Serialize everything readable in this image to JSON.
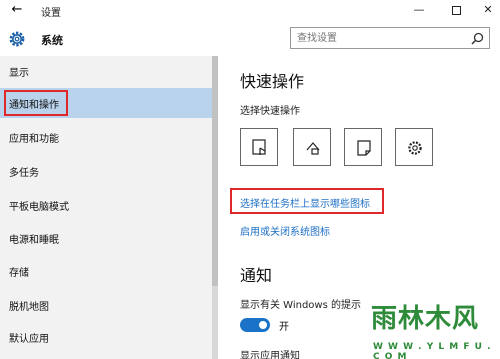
{
  "titlebar": {
    "back_icon": "back-arrow-icon",
    "title": "设置",
    "minimize": "—",
    "maximize_icon": "maximize-icon",
    "close": "✕"
  },
  "header": {
    "icon": "gear-icon",
    "title": "系统"
  },
  "search": {
    "placeholder": "查找设置",
    "icon": "search-icon"
  },
  "sidebar": {
    "items": [
      {
        "label": "显示"
      },
      {
        "label": "通知和操作",
        "selected": true
      },
      {
        "label": "应用和功能"
      },
      {
        "label": "多任务"
      },
      {
        "label": "平板电脑模式"
      },
      {
        "label": "电源和睡眠"
      },
      {
        "label": "存储"
      },
      {
        "label": "脱机地图"
      },
      {
        "label": "默认应用"
      }
    ]
  },
  "main": {
    "quick_actions_title": "快速操作",
    "quick_actions_sub": "选择快速操作",
    "quick_action_icons": [
      "tablet-mode-icon",
      "network-icon",
      "note-icon",
      "settings-icon"
    ],
    "link_taskbar_icons": "选择在任务栏上显示哪些图标",
    "link_system_icons": "启用或关闭系统图标",
    "notifications_title": "通知",
    "show_windows_tips": "显示有关 Windows 的提示",
    "toggle_state": "开",
    "show_app_notifications": "显示应用通知"
  },
  "watermark": {
    "logo_text": "雨林木风",
    "url": "W W W . Y L M F U . C O M"
  },
  "colors": {
    "selected_bg": "#bad3ec",
    "highlight_red": "#e0282b",
    "link_blue": "#1d6fc4",
    "toggle_blue": "#1a73c7"
  }
}
